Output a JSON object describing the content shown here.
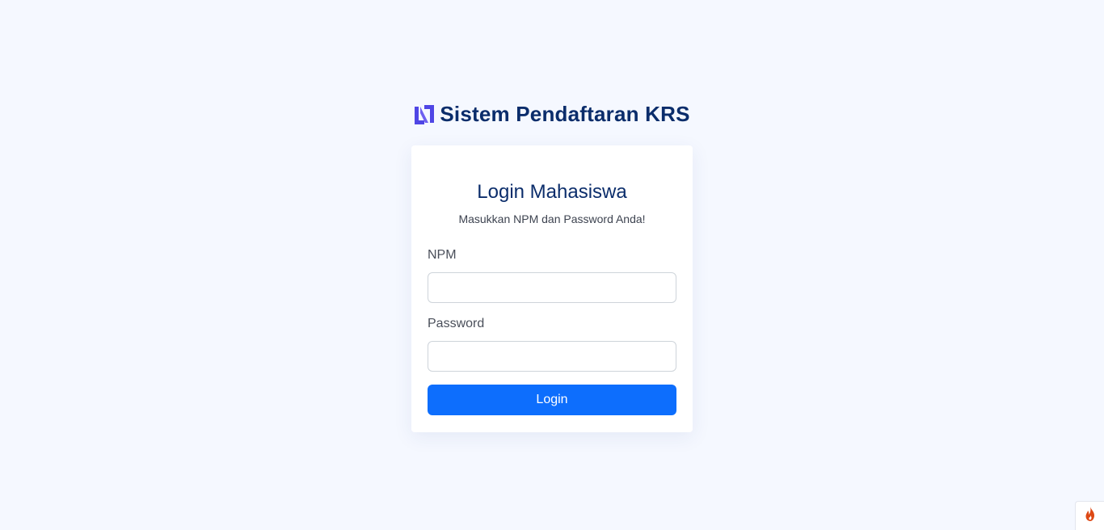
{
  "header": {
    "app_title": "Sistem Pendaftaran KRS",
    "logo_icon": "brand-logo-icon",
    "logo_color": "#4f46e5"
  },
  "login_card": {
    "title": "Login Mahasiswa",
    "subtitle": "Masukkan NPM dan Password Anda!",
    "npm_field": {
      "label": "NPM",
      "value": "",
      "placeholder": ""
    },
    "password_field": {
      "label": "Password",
      "value": "",
      "placeholder": ""
    },
    "submit_label": "Login"
  },
  "debug_toolbar": {
    "icon": "flame-icon",
    "color": "#dd4814"
  },
  "colors": {
    "background": "#f5f8ff",
    "primary": "#0d6efd",
    "heading": "#0b2d6b"
  }
}
